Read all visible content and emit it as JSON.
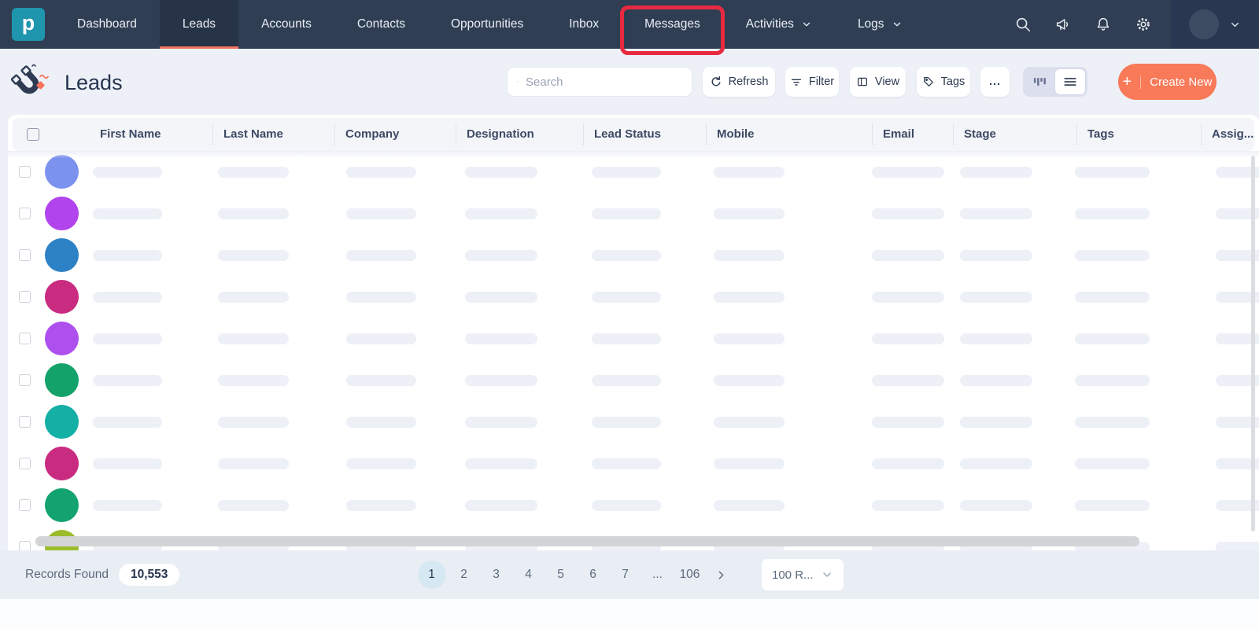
{
  "navbar": {
    "logo_letter": "p",
    "items": [
      {
        "label": "Dashboard"
      },
      {
        "label": "Leads",
        "active": true
      },
      {
        "label": "Accounts"
      },
      {
        "label": "Contacts"
      },
      {
        "label": "Opportunities"
      },
      {
        "label": "Inbox"
      },
      {
        "label": "Messages",
        "annotated": true
      },
      {
        "label": "Activities",
        "has_dropdown": true
      },
      {
        "label": "Logs",
        "has_dropdown": true
      }
    ],
    "icons": [
      "search",
      "megaphone",
      "bell",
      "gear"
    ],
    "colors": {
      "background": "#2f3e53",
      "active_underline": "#f4745e",
      "logo_bg": "#2095ae"
    }
  },
  "annotation": {
    "type": "highlight-box",
    "target": "Messages",
    "color": "#e8293f"
  },
  "page_header": {
    "title": "Leads",
    "search_placeholder": "Search",
    "buttons": {
      "refresh": "Refresh",
      "filter": "Filter",
      "view": "View",
      "tags": "Tags",
      "more": "...",
      "create_new": "Create New",
      "create_new_color": "#f87a59"
    },
    "view_toggle": {
      "options": [
        "kanban",
        "list"
      ],
      "selected": "list"
    }
  },
  "table": {
    "columns": [
      "First Name",
      "Last Name",
      "Company",
      "Designation",
      "Lead Status",
      "Mobile",
      "Email",
      "Stage",
      "Tags",
      "Assig..."
    ],
    "loading_skeleton": true,
    "rows": [
      {
        "avatar_color": "#7b93ee"
      },
      {
        "avatar_color": "#b144ec"
      },
      {
        "avatar_color": "#2d82c6"
      },
      {
        "avatar_color": "#c82b80"
      },
      {
        "avatar_color": "#ad50ee"
      },
      {
        "avatar_color": "#13a36a"
      },
      {
        "avatar_color": "#14b0a6"
      },
      {
        "avatar_color": "#c82b80"
      },
      {
        "avatar_color": "#13a36e"
      },
      {
        "avatar_color": "#9cbc2c"
      }
    ]
  },
  "footer": {
    "records_found_label": "Records Found",
    "records_count": "10,553",
    "pagination": {
      "pages": [
        "1",
        "2",
        "3",
        "4",
        "5",
        "6",
        "7",
        "...",
        "106"
      ],
      "active": "1"
    },
    "rows_per_page": "100 R..."
  }
}
